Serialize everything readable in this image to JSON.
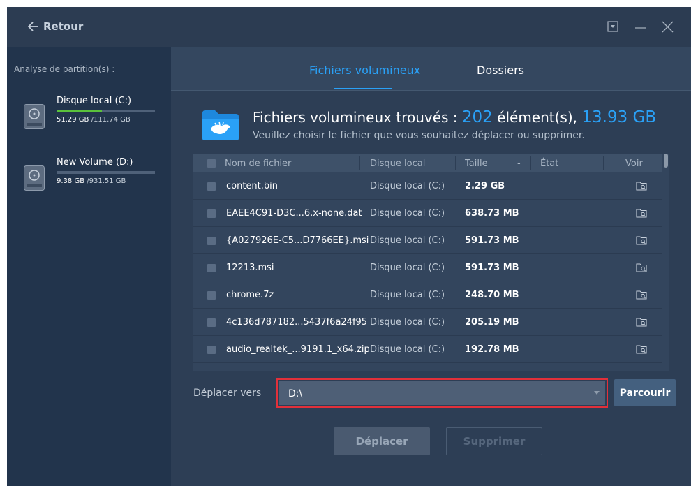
{
  "header": {
    "back_label": "Retour"
  },
  "sidebar": {
    "title": "Analyse de partition(s) :",
    "disks": [
      {
        "name": "Disque local (C:)",
        "used": "51.29 GB",
        "total": "/111.74 GB",
        "usage_fraction": 0.459,
        "bar_color": "#5ac13b"
      },
      {
        "name": "New Volume (D:)",
        "used": "9.38 GB",
        "total": "/931.51 GB",
        "usage_fraction": 0.01,
        "bar_color": "#2aa1f7"
      }
    ]
  },
  "tabs": [
    {
      "label": "Fichiers volumineux"
    },
    {
      "label": "Dossiers"
    }
  ],
  "summary": {
    "prefix": "Fichiers volumineux trouvés : ",
    "count": "202",
    "mid": " élément(s), ",
    "size": "13.93 GB",
    "subtitle": "Veuillez choisir le fichier que vous souhaitez déplacer ou supprimer."
  },
  "table": {
    "headers": {
      "name": "Nom de fichier",
      "location": "Disque local",
      "size": "Taille",
      "size_sort": "-",
      "state": "État",
      "view": "Voir"
    },
    "rows": [
      {
        "name": "content.bin",
        "location": "Disque local (C:)",
        "size": "2.29 GB"
      },
      {
        "name": "EAEE4C91-D3C...6.x-none.dat",
        "location": "Disque local (C:)",
        "size": "638.73 MB"
      },
      {
        "name": "{A027926E-C5...D7766EE}.msi",
        "location": "Disque local (C:)",
        "size": "591.73 MB"
      },
      {
        "name": "12213.msi",
        "location": "Disque local (C:)",
        "size": "591.73 MB"
      },
      {
        "name": "chrome.7z",
        "location": "Disque local (C:)",
        "size": "248.70 MB"
      },
      {
        "name": "4c136d787182...5437f6a24f95",
        "location": "Disque local (C:)",
        "size": "205.19 MB"
      },
      {
        "name": "audio_realtek_...9191.1_x64.zip",
        "location": "Disque local (C:)",
        "size": "192.78 MB"
      }
    ]
  },
  "move": {
    "label": "Déplacer vers",
    "destination": "D:\\",
    "browse_label": "Parcourir"
  },
  "actions": {
    "move_label": "Déplacer",
    "delete_label": "Supprimer"
  },
  "colors": {
    "accent": "#2aa1f7",
    "highlight_border": "#e2303a"
  }
}
